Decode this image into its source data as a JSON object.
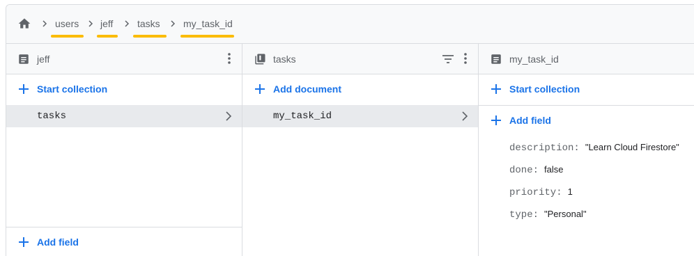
{
  "breadcrumb": {
    "items": [
      "users",
      "jeff",
      "tasks",
      "my_task_id"
    ],
    "underline_color": "#fbbc04"
  },
  "panels": {
    "document": {
      "title": "jeff",
      "start_collection_label": "Start collection",
      "collections": [
        {
          "name": "tasks"
        }
      ],
      "add_field_label": "Add field"
    },
    "collection": {
      "title": "tasks",
      "add_document_label": "Add document",
      "documents": [
        {
          "id": "my_task_id"
        }
      ]
    },
    "detail": {
      "title": "my_task_id",
      "start_collection_label": "Start collection",
      "add_field_label": "Add field",
      "fields": [
        {
          "key": "description:",
          "value": "\"Learn Cloud Firestore\""
        },
        {
          "key": "done:",
          "value": "false"
        },
        {
          "key": "priority:",
          "value": "1"
        },
        {
          "key": "type:",
          "value": "\"Personal\""
        }
      ]
    }
  },
  "colors": {
    "accent": "#1a73e8",
    "selected_row": "#e8eaed",
    "header_bg": "#f8f9fa"
  }
}
